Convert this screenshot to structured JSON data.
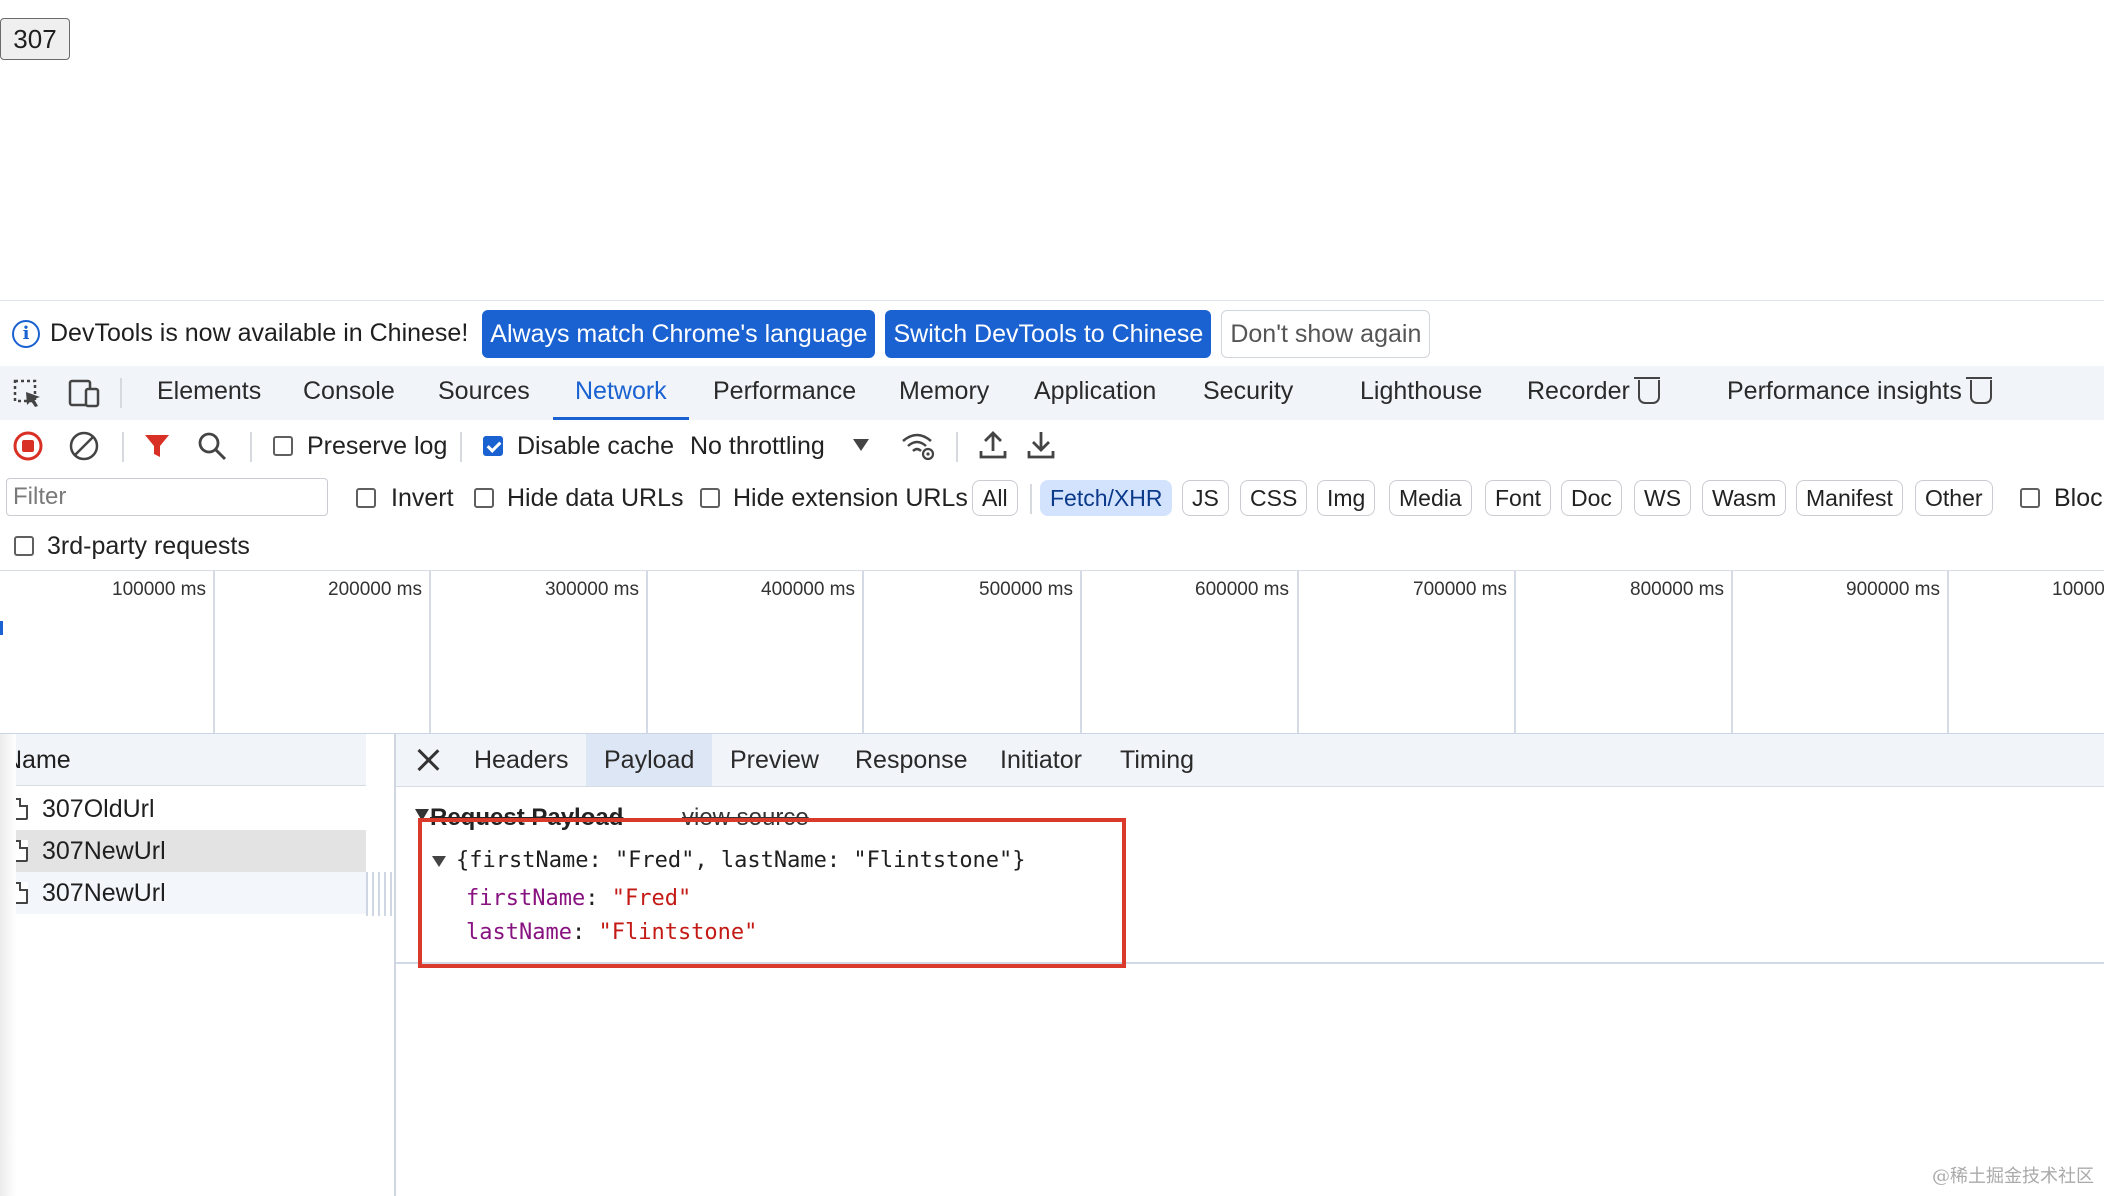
{
  "page": {
    "button_label": "307"
  },
  "infobar": {
    "message": "DevTools is now available in Chinese!",
    "always_match": "Always match Chrome's language",
    "switch": "Switch DevTools to Chinese",
    "dont_show": "Don't show again"
  },
  "tabs": {
    "elements": "Elements",
    "console": "Console",
    "sources": "Sources",
    "network": "Network",
    "performance": "Performance",
    "memory": "Memory",
    "application": "Application",
    "security": "Security",
    "lighthouse": "Lighthouse",
    "recorder": "Recorder",
    "perf_insights": "Performance insights"
  },
  "toolbar": {
    "preserve_log": "Preserve log",
    "disable_cache": "Disable cache",
    "throttling": "No throttling"
  },
  "filter": {
    "placeholder": "Filter",
    "invert": "Invert",
    "hide_data_urls": "Hide data URLs",
    "hide_ext_urls": "Hide extension URLs",
    "chips": [
      "All",
      "Fetch/XHR",
      "JS",
      "CSS",
      "Img",
      "Media",
      "Font",
      "Doc",
      "WS",
      "Wasm",
      "Manifest",
      "Other"
    ],
    "active_chip": "Fetch/XHR",
    "blocked": "Bloc",
    "third_party": "3rd-party requests"
  },
  "timeline": {
    "ticks": [
      "100000 ms",
      "200000 ms",
      "300000 ms",
      "400000 ms",
      "500000 ms",
      "600000 ms",
      "700000 ms",
      "800000 ms",
      "900000 ms",
      "10000"
    ]
  },
  "requests": {
    "header": "Name",
    "rows": [
      "307OldUrl",
      "307NewUrl",
      "307NewUrl"
    ]
  },
  "detail": {
    "tabs": [
      "Headers",
      "Payload",
      "Preview",
      "Response",
      "Initiator",
      "Timing"
    ],
    "active_tab": "Payload",
    "section_title": "Request Payload",
    "view_source": "view source",
    "summary": "{firstName: \"Fred\", lastName: \"Flintstone\"}",
    "fields": [
      {
        "key": "firstName",
        "value": "\"Fred\""
      },
      {
        "key": "lastName",
        "value": "\"Flintstone\""
      }
    ]
  },
  "watermark": "@稀土掘金技术社区",
  "colors": {
    "accent": "#1a62d1",
    "highlight_box": "#d93a2b",
    "json_key": "#881280",
    "json_string": "#c41a16"
  }
}
